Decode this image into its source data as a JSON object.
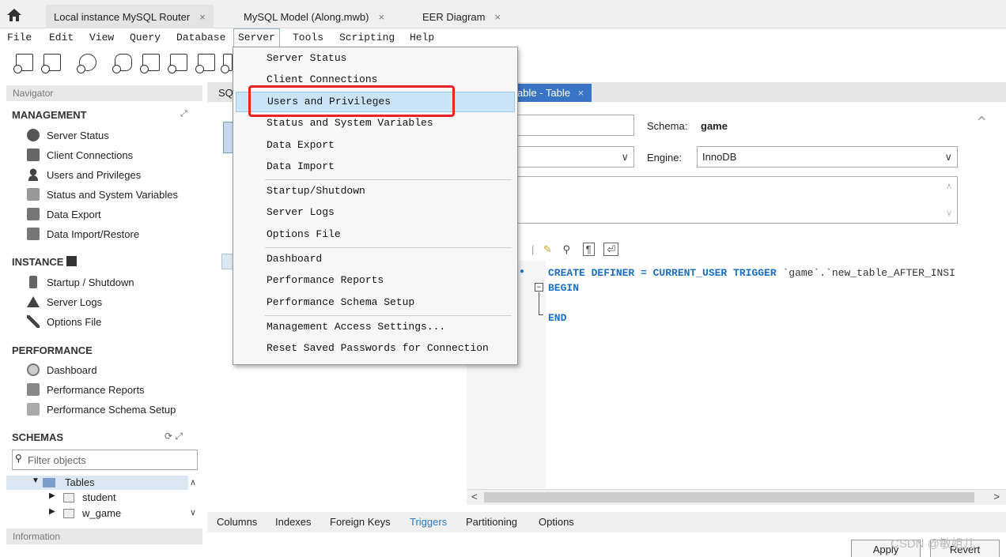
{
  "tabs": [
    {
      "label": "Local instance MySQL Router",
      "close": "×"
    },
    {
      "label": "MySQL Model (Along.mwb)",
      "close": "×"
    },
    {
      "label": "EER Diagram",
      "close": "×"
    }
  ],
  "menubar": [
    "File",
    "Edit",
    "View",
    "Query",
    "Database",
    "Server",
    "Tools",
    "Scripting",
    "Help"
  ],
  "active_menu": "Server",
  "server_menu": {
    "items": [
      "Server Status",
      "Client Connections",
      "Users and Privileges",
      "Status and System Variables",
      "Data Export",
      "Data Import",
      "Startup/Shutdown",
      "Server Logs",
      "Options File",
      "Dashboard",
      "Performance Reports",
      "Performance Schema Setup",
      "Management Access Settings...",
      "Reset Saved Passwords for Connection"
    ],
    "hovered": "Users and Privileges"
  },
  "navigator": {
    "header": "Navigator",
    "management_title": "MANAGEMENT",
    "management": [
      "Server Status",
      "Client Connections",
      "Users and Privileges",
      "Status and System Variables",
      "Data Export",
      "Data Import/Restore"
    ],
    "instance_title": "INSTANCE",
    "instance": [
      "Startup / Shutdown",
      "Server Logs",
      "Options File"
    ],
    "performance_title": "PERFORMANCE",
    "performance": [
      "Dashboard",
      "Performance Reports",
      "Performance Schema Setup"
    ],
    "schemas_title": "SCHEMAS",
    "filter_placeholder": "Filter objects",
    "tree": [
      "Tables",
      "student",
      "w_game"
    ],
    "info_header": "Information"
  },
  "editor": {
    "tab_partial": "SQ",
    "tab_active": "able - Table",
    "tab_close": "×",
    "schema_label": "Schema:",
    "schema_value": "game",
    "engine_label": "Engine:",
    "engine_value": "InnoDB",
    "code_line1_kw": "CREATE DEFINER = CURRENT_USER TRIGGER",
    "code_line1_rest": "`game`.`new_table_AFTER_INSI",
    "code_line2": "BEGIN",
    "code_line3": "END"
  },
  "bottom_tabs": [
    "Columns",
    "Indexes",
    "Foreign Keys",
    "Triggers",
    "Partitioning",
    "Options"
  ],
  "active_bottom_tab": "Triggers",
  "buttons": {
    "apply": "Apply",
    "revert": "Revert"
  },
  "watermark": "CSDN @敏姐儿",
  "colors": {
    "accent": "#3a74c4",
    "hover": "#cce4f7",
    "highlight": "#e22222",
    "keyword": "#1a6fc4"
  }
}
